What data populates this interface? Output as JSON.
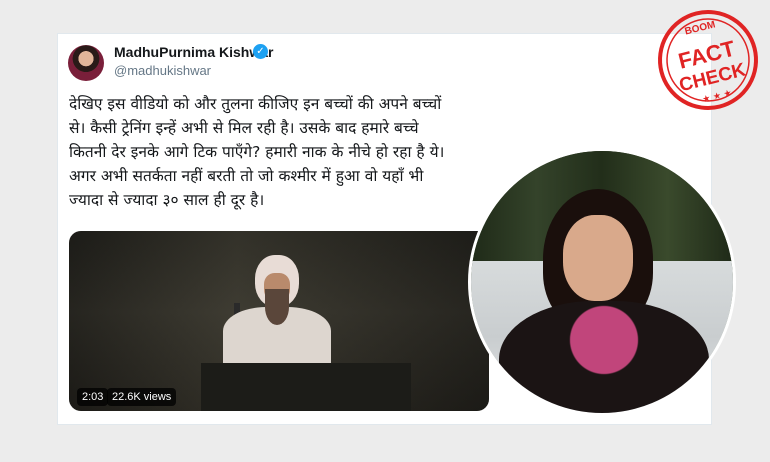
{
  "tweet": {
    "display_name": "MadhuPurnima Kishwar",
    "handle": "@madhukishwar",
    "text": "देखिए इस वीडियो को और तुलना कीजिए इन बच्चों की अपने बच्चों से। कैसी ट्रेनिंग इन्हें अभी से मिल रही है। उसके बाद हमारे बच्चे कितनी देर इनके आगे टिक पाएँगे? हमारी नाक के नीचे हो रहा है ये।अगर अभी सतर्कता नहीं बरती तो जो कश्मीर में हुआ वो यहाँ भी ज्यादा से ज्यादा ३० साल ही दूर है।"
  },
  "video": {
    "duration": "2:03",
    "views": "22.6K views"
  },
  "stamp": {
    "top": "BOOM",
    "line1": "FACT",
    "line2": "CHECK",
    "color": "#e02424"
  },
  "colors": {
    "verified": "#1da1f2"
  }
}
